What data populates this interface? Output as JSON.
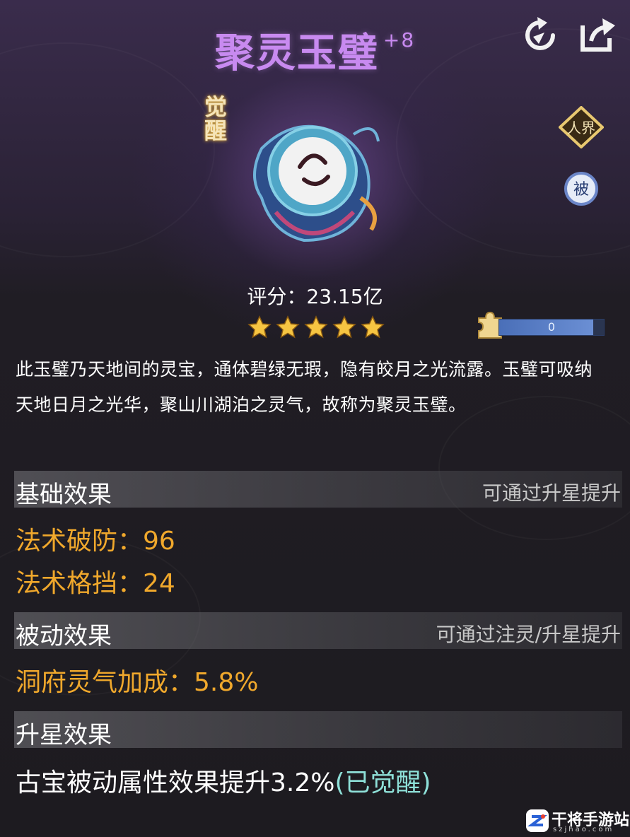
{
  "item": {
    "name": "聚灵玉璧",
    "level": "+8",
    "awaken_tag": "觉醒",
    "realm_badge": "人界",
    "passive_badge": "被",
    "score": "评分：23.15亿",
    "stars": 5,
    "fragment_count": "0",
    "fragment_progress": 0.9,
    "description": "此玉璧乃天地间的灵宝，通体碧绿无瑕，隐有皎月之光流露。玉璧可吸纳天地日月之光华，聚山川湖泊之灵气，故称为聚灵玉璧。"
  },
  "sections": {
    "basic": {
      "title": "基础效果",
      "hint": "可通过升星提升",
      "stats": [
        "法术破防：96",
        "法术格挡：24"
      ]
    },
    "passive": {
      "title": "被动效果",
      "hint": "可通过注灵/升星提升",
      "stats": [
        "洞府灵气加成：5.8%"
      ]
    },
    "star": {
      "title": "升星效果",
      "text": "古宝被动属性效果提升3.2%",
      "awakened": "(已觉醒)"
    }
  },
  "watermark": {
    "text": "干将手游站",
    "sub": "szjhao.com"
  },
  "colors": {
    "title": "#c88af0",
    "stat": "#f0a82c",
    "awakened": "#8ee0d8",
    "star": "#f6c542"
  },
  "icons": {
    "top_right_1": "refresh-arrow-icon",
    "top_right_2": "share-icon",
    "fragment": "puzzle-piece-icon"
  }
}
